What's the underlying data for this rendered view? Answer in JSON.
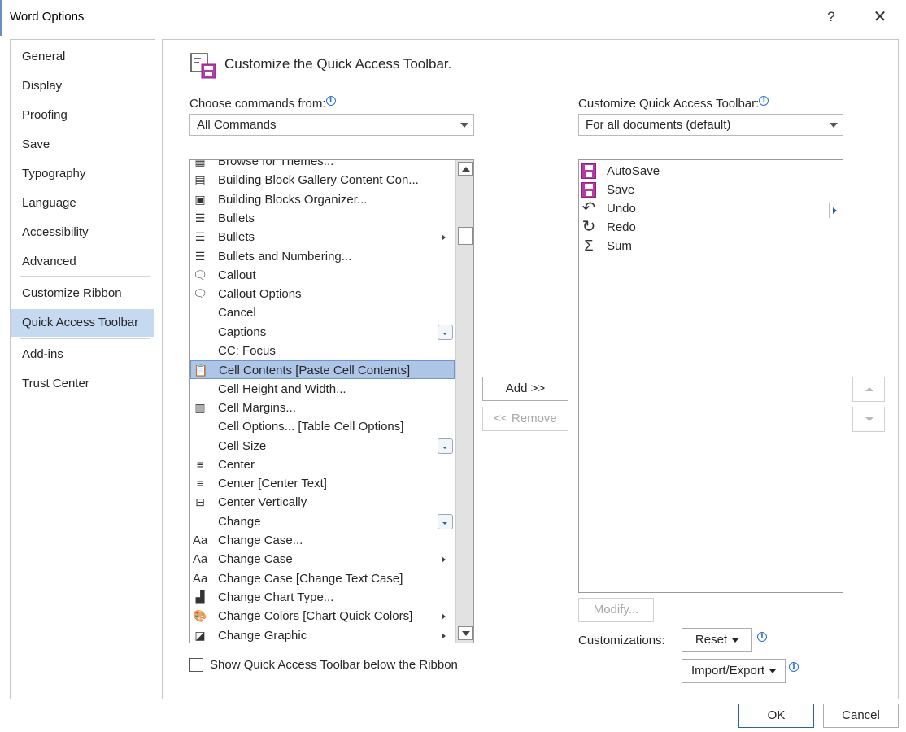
{
  "window": {
    "title": "Word Options",
    "help": "?",
    "close": "✕"
  },
  "nav": {
    "items": [
      "General",
      "Display",
      "Proofing",
      "Save",
      "Typography",
      "Language",
      "Accessibility",
      "Advanced",
      "Customize Ribbon",
      "Quick Access Toolbar",
      "Add-ins",
      "Trust Center"
    ],
    "selected": "Quick Access Toolbar"
  },
  "heading": "Customize the Quick Access Toolbar.",
  "left": {
    "label": "Choose commands from:",
    "dropdown_value": "All Commands",
    "commands": [
      {
        "label": "Browse for Themes...",
        "icon": "theme-icon",
        "glyph": "▦"
      },
      {
        "label": "Building Block Gallery Content Con...",
        "icon": "building-block-gallery-icon",
        "glyph": "▤"
      },
      {
        "label": "Building Blocks Organizer...",
        "icon": "building-blocks-icon",
        "glyph": "▣"
      },
      {
        "label": "Bullets",
        "icon": "bullets-icon",
        "glyph": "☰"
      },
      {
        "label": "Bullets",
        "icon": "bullets-icon",
        "glyph": "☰"
      },
      {
        "label": "Bullets and Numbering...",
        "icon": "bullets-numbering-icon",
        "glyph": "☰"
      },
      {
        "label": "Callout",
        "icon": "callout-icon",
        "glyph": "🗨"
      },
      {
        "label": "Callout Options",
        "icon": "callout-options-icon",
        "glyph": "🗨"
      },
      {
        "label": "Cancel",
        "icon": "",
        "glyph": ""
      },
      {
        "label": "Captions",
        "icon": "",
        "glyph": ""
      },
      {
        "label": "CC: Focus",
        "icon": "",
        "glyph": ""
      },
      {
        "label": "Cell Contents [Paste Cell Contents]",
        "icon": "paste-icon",
        "glyph": "📋"
      },
      {
        "label": "Cell Height and Width...",
        "icon": "",
        "glyph": ""
      },
      {
        "label": "Cell Margins...",
        "icon": "cell-margins-icon",
        "glyph": "▥"
      },
      {
        "label": "Cell Options... [Table Cell Options]",
        "icon": "",
        "glyph": ""
      },
      {
        "label": "Cell Size",
        "icon": "",
        "glyph": ""
      },
      {
        "label": "Center",
        "icon": "center-align-icon",
        "glyph": "≡"
      },
      {
        "label": "Center [Center Text]",
        "icon": "center-align-icon",
        "glyph": "≡"
      },
      {
        "label": "Center Vertically",
        "icon": "center-vertical-icon",
        "glyph": "⊟"
      },
      {
        "label": "Change",
        "icon": "",
        "glyph": ""
      },
      {
        "label": "Change Case...",
        "icon": "change-case-icon",
        "glyph": "Aa"
      },
      {
        "label": "Change Case",
        "icon": "change-case-icon",
        "glyph": "Aa"
      },
      {
        "label": "Change Case [Change Text Case]",
        "icon": "change-case-icon",
        "glyph": "Aa"
      },
      {
        "label": "Change Chart Type...",
        "icon": "chart-type-icon",
        "glyph": "▟"
      },
      {
        "label": "Change Colors [Chart Quick Colors]",
        "icon": "palette-icon",
        "glyph": "🎨"
      },
      {
        "label": "Change Graphic",
        "icon": "change-graphic-icon",
        "glyph": "◪"
      }
    ],
    "selected_index": 11,
    "submenu_rows": [
      4,
      21,
      24,
      25
    ],
    "gallery_rows": [
      9,
      15,
      19
    ],
    "checkbox_label": "Show Quick Access Toolbar below the Ribbon"
  },
  "right": {
    "label": "Customize Quick Access Toolbar:",
    "dropdown_value": "For all documents (default)",
    "items": [
      {
        "label": "AutoSave",
        "icon": "autosave-icon"
      },
      {
        "label": "Save",
        "icon": "save-icon"
      },
      {
        "label": "Undo",
        "icon": "undo-icon",
        "glyph": "↶"
      },
      {
        "label": "Redo",
        "icon": "redo-icon",
        "glyph": "↻"
      },
      {
        "label": "Sum",
        "icon": "sum-icon",
        "glyph": "Σ"
      }
    ],
    "modify_label": "Modify...",
    "customizations_label": "Customizations:",
    "reset_label": "Reset",
    "import_export_label": "Import/Export"
  },
  "buttons": {
    "add": "Add >>",
    "remove": "<< Remove",
    "ok": "OK",
    "cancel": "Cancel"
  },
  "colors": {
    "selection": "#c5d9f1",
    "list_selection": "#adc5e6",
    "save_icon": "#b639a7",
    "accent": "#2b70d3"
  }
}
